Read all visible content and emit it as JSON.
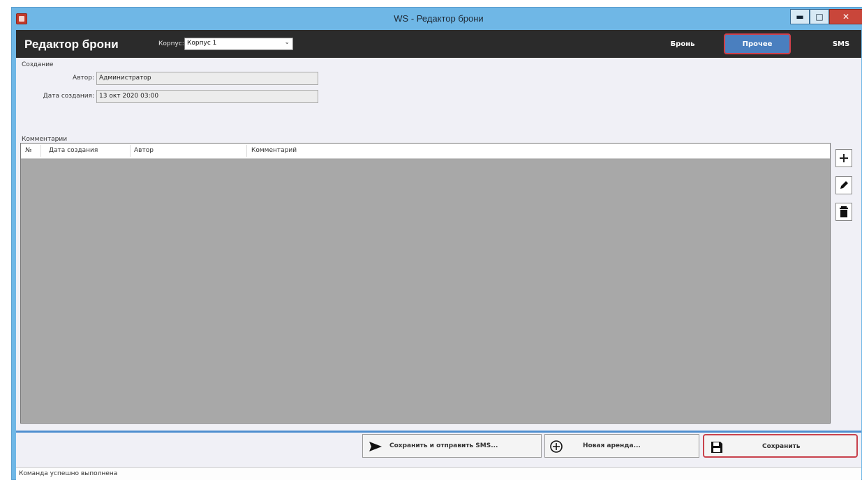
{
  "window": {
    "title": "WS - Редактор брони"
  },
  "header": {
    "title": "Редактор брони",
    "corp_label": "Корпус:",
    "corp_value": "Корпус 1",
    "tabs": [
      "Бронь",
      "Прочее",
      "SMS"
    ]
  },
  "creation": {
    "section": "Создание",
    "author_label": "Автор:",
    "author_value": "Администратор",
    "date_label": "Дата создания:",
    "date_value": "13 окт 2020  03:00"
  },
  "comments": {
    "section": "Комментарии",
    "columns": [
      "№",
      "Дата создания",
      "Автор",
      "Комментарий"
    ]
  },
  "side_icons": [
    "plus-icon",
    "pencil-icon",
    "trash-icon"
  ],
  "footer": {
    "save_send_label": "Сохранить и отправить SMS...",
    "new_rent_label": "Новая аренда...",
    "save_label": "Сохранить"
  },
  "status": "Команда успешно выполнена"
}
